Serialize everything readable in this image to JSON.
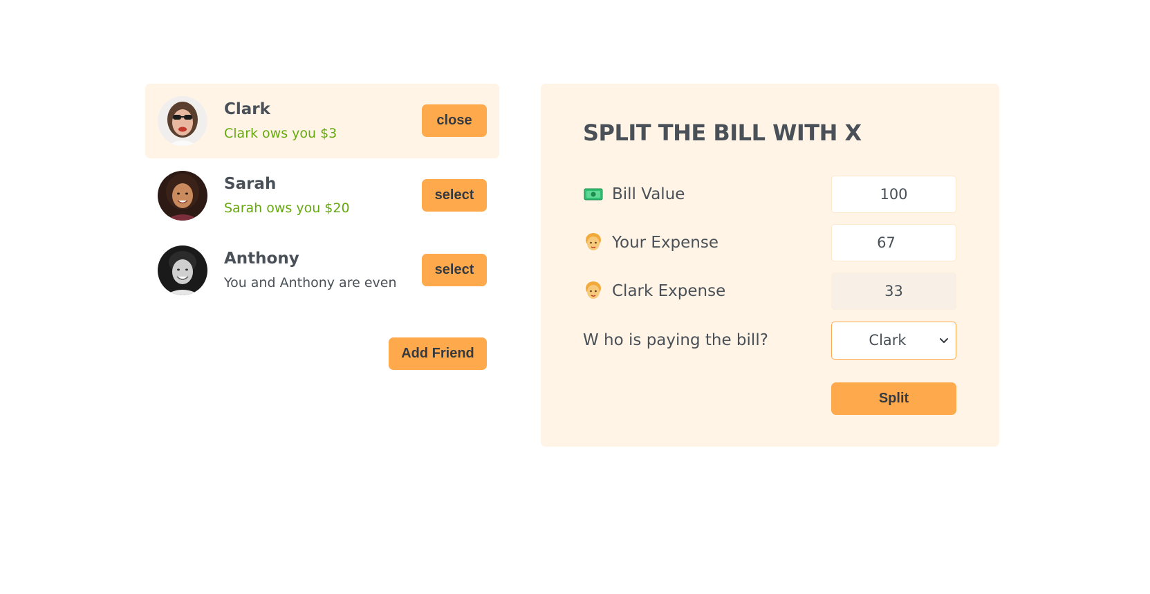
{
  "friends": [
    {
      "name": "Clark",
      "status": "Clark ows you $3",
      "status_type": "positive",
      "button": "close",
      "selected": true
    },
    {
      "name": "Sarah",
      "status": "Sarah ows you $20",
      "status_type": "positive",
      "button": "select",
      "selected": false
    },
    {
      "name": "Anthony",
      "status": "You and Anthony are even",
      "status_type": "even",
      "button": "select",
      "selected": false
    }
  ],
  "add_friend_label": "Add Friend",
  "split": {
    "title": "SPLIT THE BILL WITH X",
    "bill_label": "Bill Value",
    "bill_value": "100",
    "your_expense_label": "Your Expense",
    "your_expense_value": "67",
    "friend_expense_label": "Clark Expense",
    "friend_expense_value": "33",
    "payer_label": "W ho is paying the bill?",
    "payer_selected": "Clark",
    "submit_label": "Split"
  },
  "colors": {
    "accent": "#ffa94d",
    "panel": "#fff4e6",
    "positive": "#66a80f",
    "text": "#495057"
  },
  "icons": {
    "bill": "money-icon",
    "person": "person-icon",
    "dropdown": "chevron-down-icon"
  }
}
